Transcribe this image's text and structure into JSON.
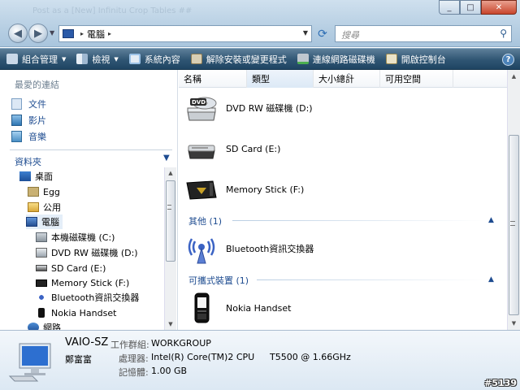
{
  "window": {
    "ghost_text": "Post as a [New]     Infinitu     Crop Tables     ##",
    "minimize": "_",
    "maximize": "□",
    "close": "✕"
  },
  "address": {
    "separator": "▸",
    "location": "電腦",
    "search_placeholder": "搜尋"
  },
  "commands": [
    {
      "label": "組合管理",
      "icon": "organize-icon",
      "dropdown": true
    },
    {
      "label": "檢視",
      "icon": "views-icon",
      "dropdown": true
    },
    {
      "label": "系統內容",
      "icon": "system-properties-icon",
      "dropdown": false
    },
    {
      "label": "解除安裝或變更程式",
      "icon": "uninstall-icon",
      "dropdown": false
    },
    {
      "label": "連線網路磁碟機",
      "icon": "map-drive-icon",
      "dropdown": false
    },
    {
      "label": "開啟控制台",
      "icon": "control-panel-icon",
      "dropdown": false
    }
  ],
  "help_label": "?",
  "sidebar": {
    "favorites_title": "最愛的連結",
    "favorites": [
      {
        "label": "文件",
        "icon": "documents-icon"
      },
      {
        "label": "影片",
        "icon": "pictures-icon"
      },
      {
        "label": "音樂",
        "icon": "music-icon"
      }
    ],
    "folders_title": "資料夾",
    "tree": [
      {
        "label": "桌面",
        "icon": "desktop-icon",
        "level": 0
      },
      {
        "label": "Egg",
        "icon": "user-folder-icon",
        "level": 1
      },
      {
        "label": "公用",
        "icon": "public-folder-icon",
        "level": 1
      },
      {
        "label": "電腦",
        "icon": "computer-icon",
        "level": 1,
        "selected": true
      },
      {
        "label": "本機磁碟機 (C:)",
        "icon": "local-disk-icon",
        "level": 2
      },
      {
        "label": "DVD RW 磁碟機 (D:)",
        "icon": "dvd-drive-icon",
        "level": 2
      },
      {
        "label": "SD Card (E:)",
        "icon": "sd-card-icon",
        "level": 2
      },
      {
        "label": "Memory Stick (F:)",
        "icon": "memory-stick-icon",
        "level": 2
      },
      {
        "label": "Bluetooth資訊交換器",
        "icon": "bluetooth-icon",
        "level": 2
      },
      {
        "label": "Nokia Handset",
        "icon": "phone-icon",
        "level": 2
      },
      {
        "label": "網路",
        "icon": "network-icon",
        "level": 1
      }
    ]
  },
  "columns": [
    "名稱",
    "類型",
    "大小總計",
    "可用空間"
  ],
  "sort_indicator": "^",
  "items": [
    {
      "label": "DVD RW 磁碟機 (D:)",
      "icon": "dvd-drive-icon"
    },
    {
      "label": "SD Card (E:)",
      "icon": "sd-card-icon"
    },
    {
      "label": "Memory Stick (F:)",
      "icon": "memory-stick-icon"
    }
  ],
  "groups": [
    {
      "title": "其他 (1)",
      "items": [
        {
          "label": "Bluetooth資訊交換器",
          "icon": "bluetooth-icon"
        }
      ]
    },
    {
      "title": "可攜式裝置 (1)",
      "items": [
        {
          "label": "Nokia Handset",
          "icon": "phone-icon"
        }
      ]
    }
  ],
  "dvd_badge": "DVD",
  "details": {
    "computer_name": "VAIO-SZ",
    "owner": "鄭富富",
    "workgroup_label": "工作群組:",
    "workgroup_value": "WORKGROUP",
    "processor_label": "處理器:",
    "processor_value": "Intel(R) Core(TM)2 CPU",
    "processor_model": "T5500  @ 1.66GHz",
    "memory_label": "記憶體:",
    "memory_value": "1.00 GB"
  },
  "watermark": "#5139",
  "colors": {
    "accent": "#1e4c90",
    "cmdbar": "#2f5573"
  }
}
